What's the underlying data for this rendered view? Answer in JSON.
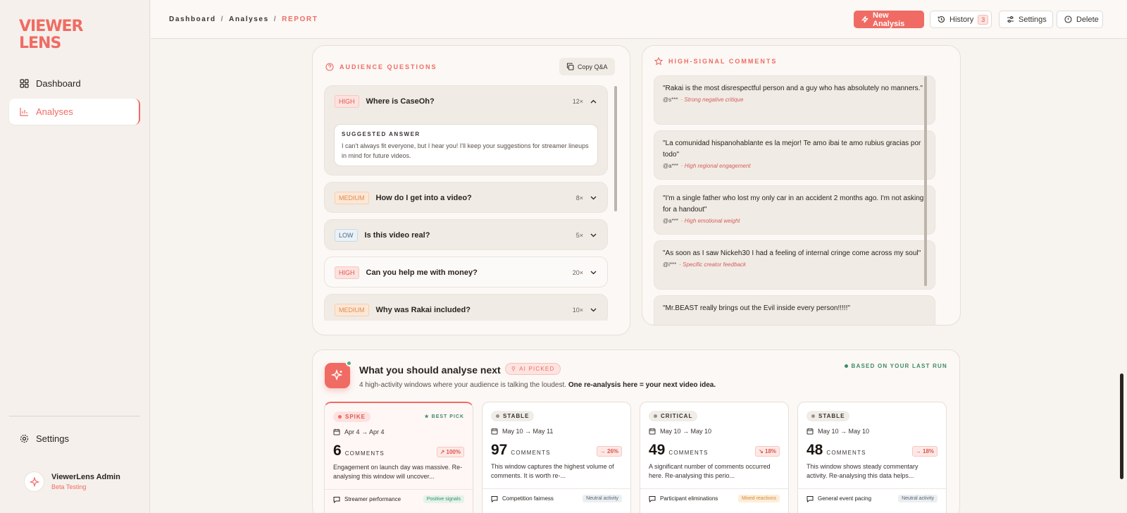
{
  "sidebar": {
    "logo_line1": "VIEWER",
    "logo_line2": "LENS",
    "items": [
      {
        "label": "Dashboard",
        "icon": "dashboard-icon"
      },
      {
        "label": "Analyses",
        "icon": "bar-chart-icon"
      }
    ],
    "settings_label": "Settings",
    "user_name": "ViewerLens Admin",
    "user_role": "Beta Testing"
  },
  "topbar": {
    "crumb1": "Dashboard",
    "crumb2": "Analyses",
    "crumb3": "REPORT",
    "new_analysis": "New Analysis",
    "history": "History",
    "history_count": "3",
    "settings": "Settings",
    "delete": "Delete"
  },
  "questions": {
    "title": "AUDIENCE QUESTIONS",
    "copy_label": "Copy Q&A",
    "suggest_label": "SUGGESTED ANSWER",
    "suggest_text": "I can't always fit everyone, but I hear you! I'll keep your suggestions for streamer lineups in mind for future videos.",
    "items": [
      {
        "priority": "HIGH",
        "text": "Where is CaseOh?",
        "count": "12×"
      },
      {
        "priority": "MEDIUM",
        "text": "How do I get into a video?",
        "count": "8×"
      },
      {
        "priority": "LOW",
        "text": "Is this video real?",
        "count": "5×"
      },
      {
        "priority": "HIGH",
        "text": "Can you help me with money?",
        "count": "20×"
      },
      {
        "priority": "MEDIUM",
        "text": "Why was Rakai included?",
        "count": "10×"
      }
    ]
  },
  "comments": {
    "title": "HIGH-SIGNAL COMMENTS",
    "items": [
      {
        "text": "\"Rakai is the most disrespectful person and a guy who has absolutely no manners.\"",
        "user": "@s***",
        "tag": "· Strong negative critique"
      },
      {
        "text": "\"La comunidad hispanohablante es la mejor! Te amo ibai te amo rubius gracias por todo\"",
        "user": "@a***",
        "tag": "· High regional engagement"
      },
      {
        "text": "\"I'm a single father who lost my only car in an accident 2 months ago. I'm not asking for a handout\"",
        "user": "@a***",
        "tag": "· High emotional weight"
      },
      {
        "text": "\"As soon as I saw Nickeh30 I had a feeling of internal cringe come across my soul\"",
        "user": "@i***",
        "tag": "· Specific creator feedback"
      },
      {
        "text": "\"Mr.BEAST really brings out the Evil inside every person!!!!!\"",
        "user": "",
        "tag": ""
      }
    ]
  },
  "next": {
    "title": "What you should analyse next",
    "ai_label": "AI PICKED",
    "based_label": "BASED ON YOUR LAST RUN",
    "sub_plain": "4 high-activity windows where your audience is talking the loudest.",
    "sub_bold": "One re-analysis here = your next video idea.",
    "comments_label": "COMMENTS",
    "best_pick": "★ BEST PICK",
    "windows": [
      {
        "status": "SPIKE",
        "date": "Apr 4 → Apr 4",
        "count": "6",
        "delta": "↗ 100%",
        "desc": "Engagement on launch day was massive. Re-analysing this window will uncover...",
        "topic": "Streamer performance",
        "signal": "Positive signals"
      },
      {
        "status": "STABLE",
        "date": "May 10 → May 11",
        "count": "97",
        "delta": "→ 26%",
        "desc": "This window captures the highest volume of comments. It is worth re-...",
        "topic": "Competition fairness",
        "signal": "Neutral activity"
      },
      {
        "status": "CRITICAL",
        "date": "May 10 → May 10",
        "count": "49",
        "delta": "↘ 18%",
        "desc": "A significant number of comments occurred here. Re-analysing this perio...",
        "topic": "Participant eliminations",
        "signal": "Mixed reactions"
      },
      {
        "status": "STABLE",
        "date": "May 10 → May 10",
        "count": "48",
        "delta": "→ 18%",
        "desc": "This window shows steady commentary activity. Re-analysing this data helps...",
        "topic": "General event pacing",
        "signal": "Neutral activity"
      }
    ]
  },
  "colors": {
    "accent": "#f06b63",
    "background": "#f7f3ef",
    "positive": "#3d8c64"
  }
}
